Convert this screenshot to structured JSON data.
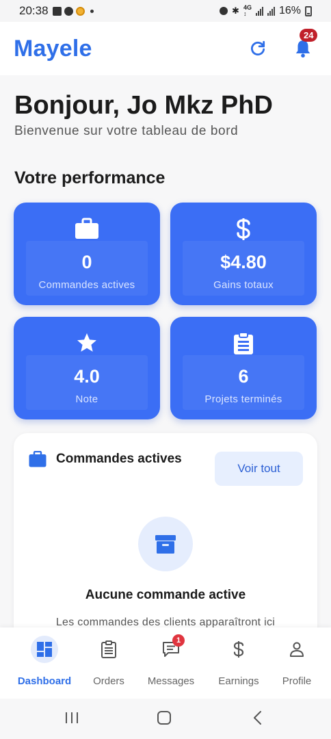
{
  "status_bar": {
    "time": "20:38",
    "battery": "16%"
  },
  "app": {
    "name": "Mayele",
    "notification_count": "24"
  },
  "header": {
    "greeting": "Bonjour, Jo Mkz PhD",
    "subtitle": "Bienvenue sur votre tableau de bord"
  },
  "performance": {
    "title": "Votre performance",
    "cards": [
      {
        "icon": "briefcase-icon",
        "value": "0",
        "label": "Commandes actives"
      },
      {
        "icon": "dollar-icon",
        "value": "$4.80",
        "label": "Gains totaux"
      },
      {
        "icon": "star-icon",
        "value": "4.0",
        "label": "Note"
      },
      {
        "icon": "clipboard-icon",
        "value": "6",
        "label": "Projets terminés"
      }
    ]
  },
  "active_orders": {
    "title": "Commandes actives",
    "view_all": "Voir tout",
    "empty_title": "Aucune commande active",
    "empty_text": "Les commandes des clients apparaîtront ici"
  },
  "bottom_nav": {
    "items": [
      {
        "label": "Dashboard",
        "icon": "dashboard-icon",
        "active": true
      },
      {
        "label": "Orders",
        "icon": "orders-icon"
      },
      {
        "label": "Messages",
        "icon": "messages-icon",
        "badge": "1"
      },
      {
        "label": "Earnings",
        "icon": "dollar-icon"
      },
      {
        "label": "Profile",
        "icon": "profile-icon"
      }
    ]
  },
  "colors": {
    "primary": "#2f6fe8",
    "card": "#3b6ef5",
    "badge": "#c0202a"
  }
}
